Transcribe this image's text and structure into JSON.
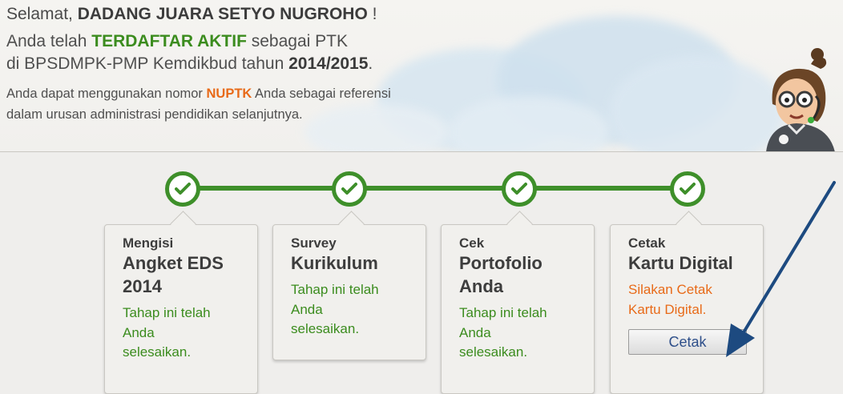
{
  "header": {
    "greeting_prefix": "Selamat, ",
    "user_name": "DADANG JUARA SETYO NUGROHO",
    "greeting_suffix": " !",
    "status_prefix": "Anda telah ",
    "status_value": "TERDAFTAR AKTIF",
    "status_suffix": " sebagai PTK",
    "org_prefix": "di BPSDMPK-PMP Kemdikbud tahun ",
    "year": "2014/2015",
    "org_suffix": ".",
    "info_prefix": "Anda dapat menggunakan nomor ",
    "info_highlight": "NUPTK",
    "info_suffix": " Anda sebagai referensi",
    "info_line2": "dalam urusan administrasi pendidikan selanjutnya."
  },
  "steps": [
    {
      "small": "Mengisi",
      "title_lines": [
        "Angket EDS",
        "2014"
      ],
      "status_lines": [
        "Tahap ini telah",
        "Anda",
        "selesaikan."
      ],
      "state": "done"
    },
    {
      "small": "Survey",
      "title_lines": [
        "Kurikulum"
      ],
      "status_lines": [
        "Tahap ini telah",
        "Anda",
        "selesaikan."
      ],
      "state": "done"
    },
    {
      "small": "Cek",
      "title_lines": [
        "Portofolio",
        "Anda"
      ],
      "status_lines": [
        "Tahap ini telah",
        "Anda",
        "selesaikan."
      ],
      "state": "done"
    },
    {
      "small": "Cetak",
      "title_lines": [
        "Kartu Digital"
      ],
      "status_lines": [
        "Silakan Cetak",
        "Kartu Digital."
      ],
      "state": "todo",
      "button_label": "Cetak"
    }
  ],
  "colors": {
    "green": "#3e8f2a",
    "orange": "#e86a18",
    "arrow": "#1d4a80"
  },
  "icons": {
    "step_node": "check-icon",
    "mascot": "mascot-illustration",
    "pointer": "arrow-annotation"
  }
}
